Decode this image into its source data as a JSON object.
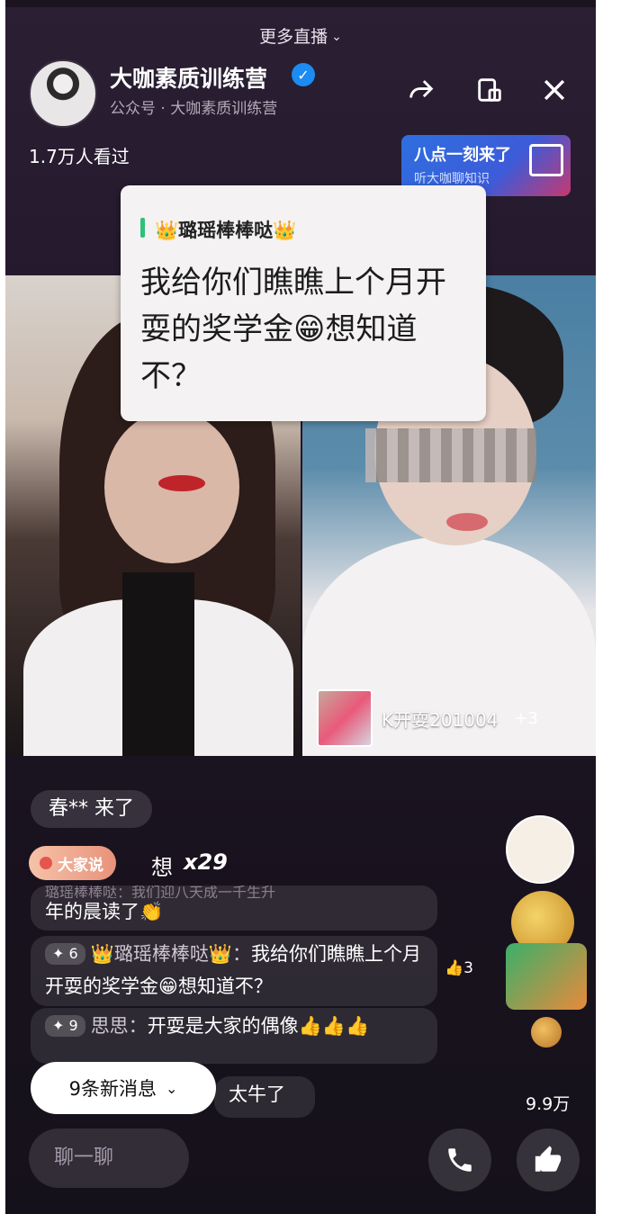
{
  "header": {
    "more_live": "更多直播",
    "host_name": "大咖素质训练营",
    "host_sub": "公众号 · 大咖素质训练营",
    "viewers": "1.7万人看过"
  },
  "promo": {
    "line1": "八点一刻来了",
    "line2": "听大咖聊知识"
  },
  "pinned_bubble": {
    "author": "👑璐瑶棒棒哒👑",
    "message": "我给你们瞧瞧上个月开耍的奖学金😁想知道不？"
  },
  "guest": {
    "name": "K开耍201004",
    "extra": "+3"
  },
  "chat": {
    "join_notice": "春** 来了",
    "gift_pill": "大家说",
    "combo_word": "想",
    "combo_count": "x29",
    "comments": [
      {
        "faded": "璐瑶棒棒哒：我们迎八天成一千生升",
        "text": "年的晨读了👏"
      },
      {
        "level": "6",
        "name": "👑璐瑶棒棒哒👑：",
        "text": "我给你们瞧瞧上个月开耍的奖学金😁想知道不？"
      },
      {
        "level": "9",
        "name": "思思：",
        "text": "开耍是大家的偶像👍👍👍"
      },
      {
        "text": "太牛了"
      }
    ],
    "like_count": "3"
  },
  "new_messages": "9条新消息",
  "total_likes": "9.9万",
  "input_placeholder": "聊一聊",
  "colors": {
    "accent_verified": "#1c8bf2",
    "bar_green": "#2ec17a"
  }
}
